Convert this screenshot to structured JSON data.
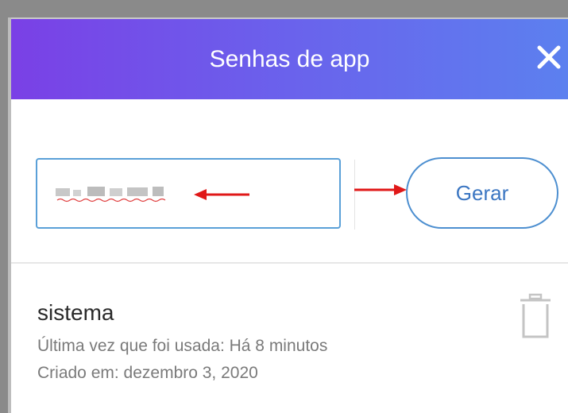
{
  "dialog": {
    "title": "Senhas de app",
    "close_icon": "close-icon",
    "header_gradient": [
      "#7a40e6",
      "#5c80ef"
    ]
  },
  "generator": {
    "input_value": "",
    "input_state": "obscured",
    "generate_label": "Gerar",
    "accent_color": "#4d8fd0"
  },
  "passwords": [
    {
      "name": "sistema",
      "last_used": "Última vez que foi usada: Há 8 minutos",
      "created": "Criado em: dezembro 3, 2020",
      "delete_icon": "trash-icon"
    }
  ],
  "annotations": {
    "arrow_color": "#e01818",
    "arrows": [
      "arrow-left",
      "arrow-right"
    ]
  }
}
